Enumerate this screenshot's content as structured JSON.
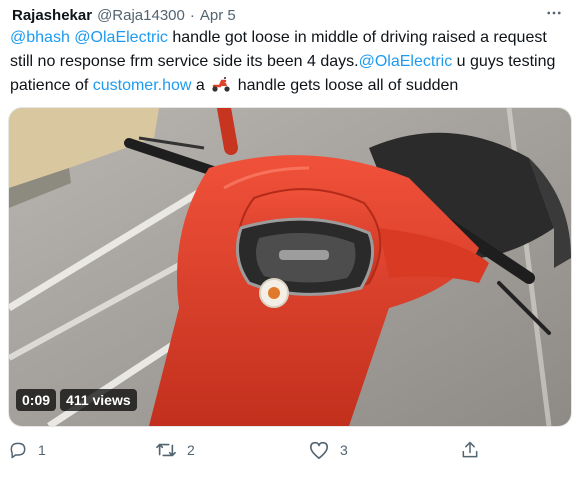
{
  "tweet": {
    "author_name": "Rajashekar",
    "author_handle": "@Raja14300",
    "separator": "·",
    "date": "Apr 5",
    "more_label": "···",
    "text": {
      "mention_1": "@bhash",
      "mention_2": "@OlaElectric",
      "part_1": " handle got loose in middle of driving raised a request still no response frm service side its been 4 days.",
      "mention_3": "@OlaElectric",
      "part_2": " u guys testing patience of ",
      "link": "customer.how",
      "part_3": " a ",
      "emoji": "motor-scooter-emoji",
      "part_4": " handle gets loose all of sudden"
    }
  },
  "video": {
    "duration": "0:09",
    "views": "411 views"
  },
  "actions": {
    "reply_count": "1",
    "retweet_count": "2",
    "like_count": "3"
  },
  "icons": [
    "more-icon",
    "reply-icon",
    "retweet-icon",
    "like-icon",
    "share-icon"
  ],
  "colors": {
    "link": "#1d9bf0",
    "muted": "#536471",
    "scooter_red": "#e0412a"
  }
}
